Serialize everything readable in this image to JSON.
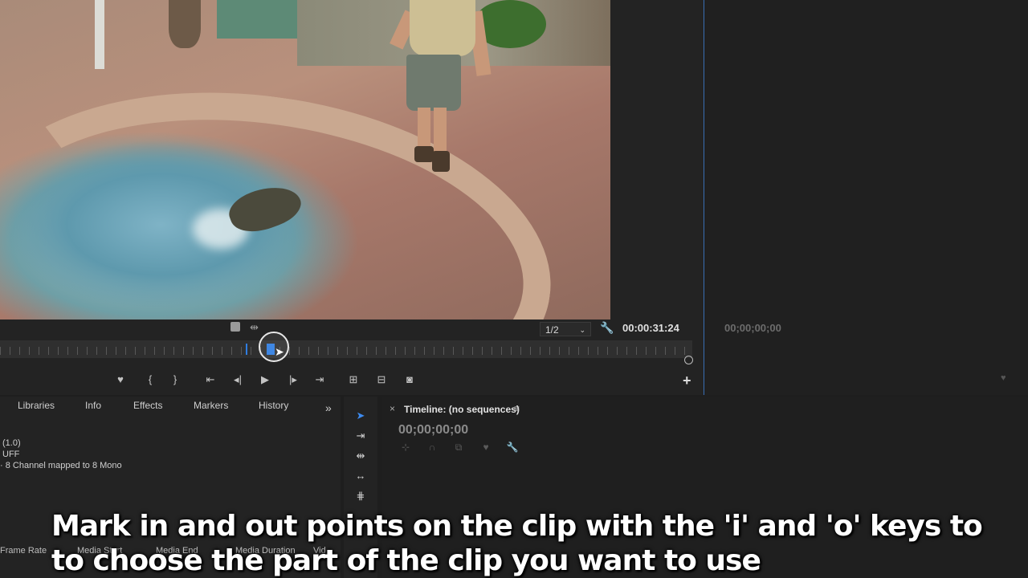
{
  "source_monitor": {
    "zoom": "1/2",
    "timecode": "00:00:31:24",
    "playhead_position_percent": 39
  },
  "program_monitor": {
    "timecode": "00;00;00;00"
  },
  "project_panel": {
    "tabs": [
      "Libraries",
      "Info",
      "Effects",
      "Markers",
      "History"
    ],
    "overflow": "»",
    "info_lines": [
      "(1.0)",
      "UFF",
      "· 8 Channel mapped to 8 Mono"
    ],
    "column_headers": [
      "Frame Rate",
      "Media Start",
      "Media End",
      "Media Duration",
      "Vid"
    ]
  },
  "timeline": {
    "title": "Timeline: (no sequences)",
    "close": "×",
    "menu": "≡",
    "timecode": "00;00;00;00"
  },
  "caption": {
    "line1": "Mark in and out points on the clip with the 'i' and 'o' keys to",
    "line2": "to choose the part of the clip you want to use"
  },
  "colors": {
    "accent": "#2f7de1",
    "panel_bg": "#232323",
    "panel_border_active": "#3a6fb5"
  },
  "icons": {
    "marker": "marker-icon",
    "mark_in": "mark-in-icon",
    "mark_out": "mark-out-icon",
    "go_to_in": "go-to-in-icon",
    "step_back": "step-back-icon",
    "play": "play-icon",
    "step_forward": "step-forward-icon",
    "go_to_out": "go-to-out-icon",
    "insert": "insert-icon",
    "overwrite": "overwrite-icon",
    "export_frame": "camera-icon",
    "settings": "wrench-icon",
    "add": "plus-icon"
  }
}
